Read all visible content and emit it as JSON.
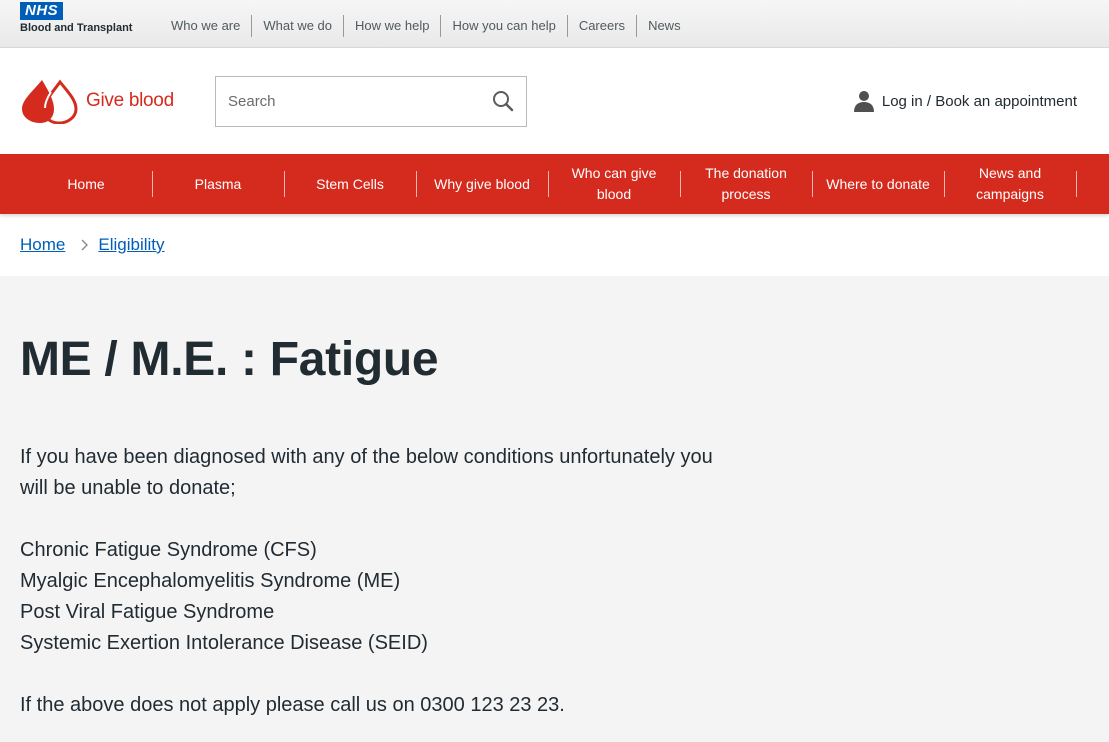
{
  "utility_bar": {
    "logo_badge": "NHS",
    "logo_subtitle": "Blood and Transplant",
    "links": [
      "Who we are",
      "What we do",
      "How we help",
      "How you can help",
      "Careers",
      "News"
    ]
  },
  "header": {
    "brand_text": "Give blood",
    "search": {
      "placeholder": "Search",
      "icon": "search-icon"
    },
    "account_label": "Log in / Book an appointment",
    "account_icon": "user-icon",
    "brand_color": "#d52b1e"
  },
  "main_nav": {
    "items": [
      "Home",
      "Plasma",
      "Stem Cells",
      "Why give blood",
      "Who can give blood",
      "The donation process",
      "Where to donate",
      "News and campaigns"
    ],
    "background": "#d52b1e"
  },
  "breadcrumb": {
    "items": [
      "Home",
      "Eligibility"
    ],
    "link_color": "#005eb8"
  },
  "content": {
    "title": "ME / M.E. : Fatigue",
    "intro": "If you have been diagnosed with any of the below conditions unfortunately you will be unable to donate;",
    "conditions": [
      "Chronic Fatigue Syndrome (CFS)",
      "Myalgic Encephalomyelitis Syndrome (ME)",
      "Post Viral Fatigue Syndrome",
      "Systemic Exertion Intolerance Disease (SEID)"
    ],
    "footnote": "If the above does not apply please call us on 0300 123 23 23."
  }
}
